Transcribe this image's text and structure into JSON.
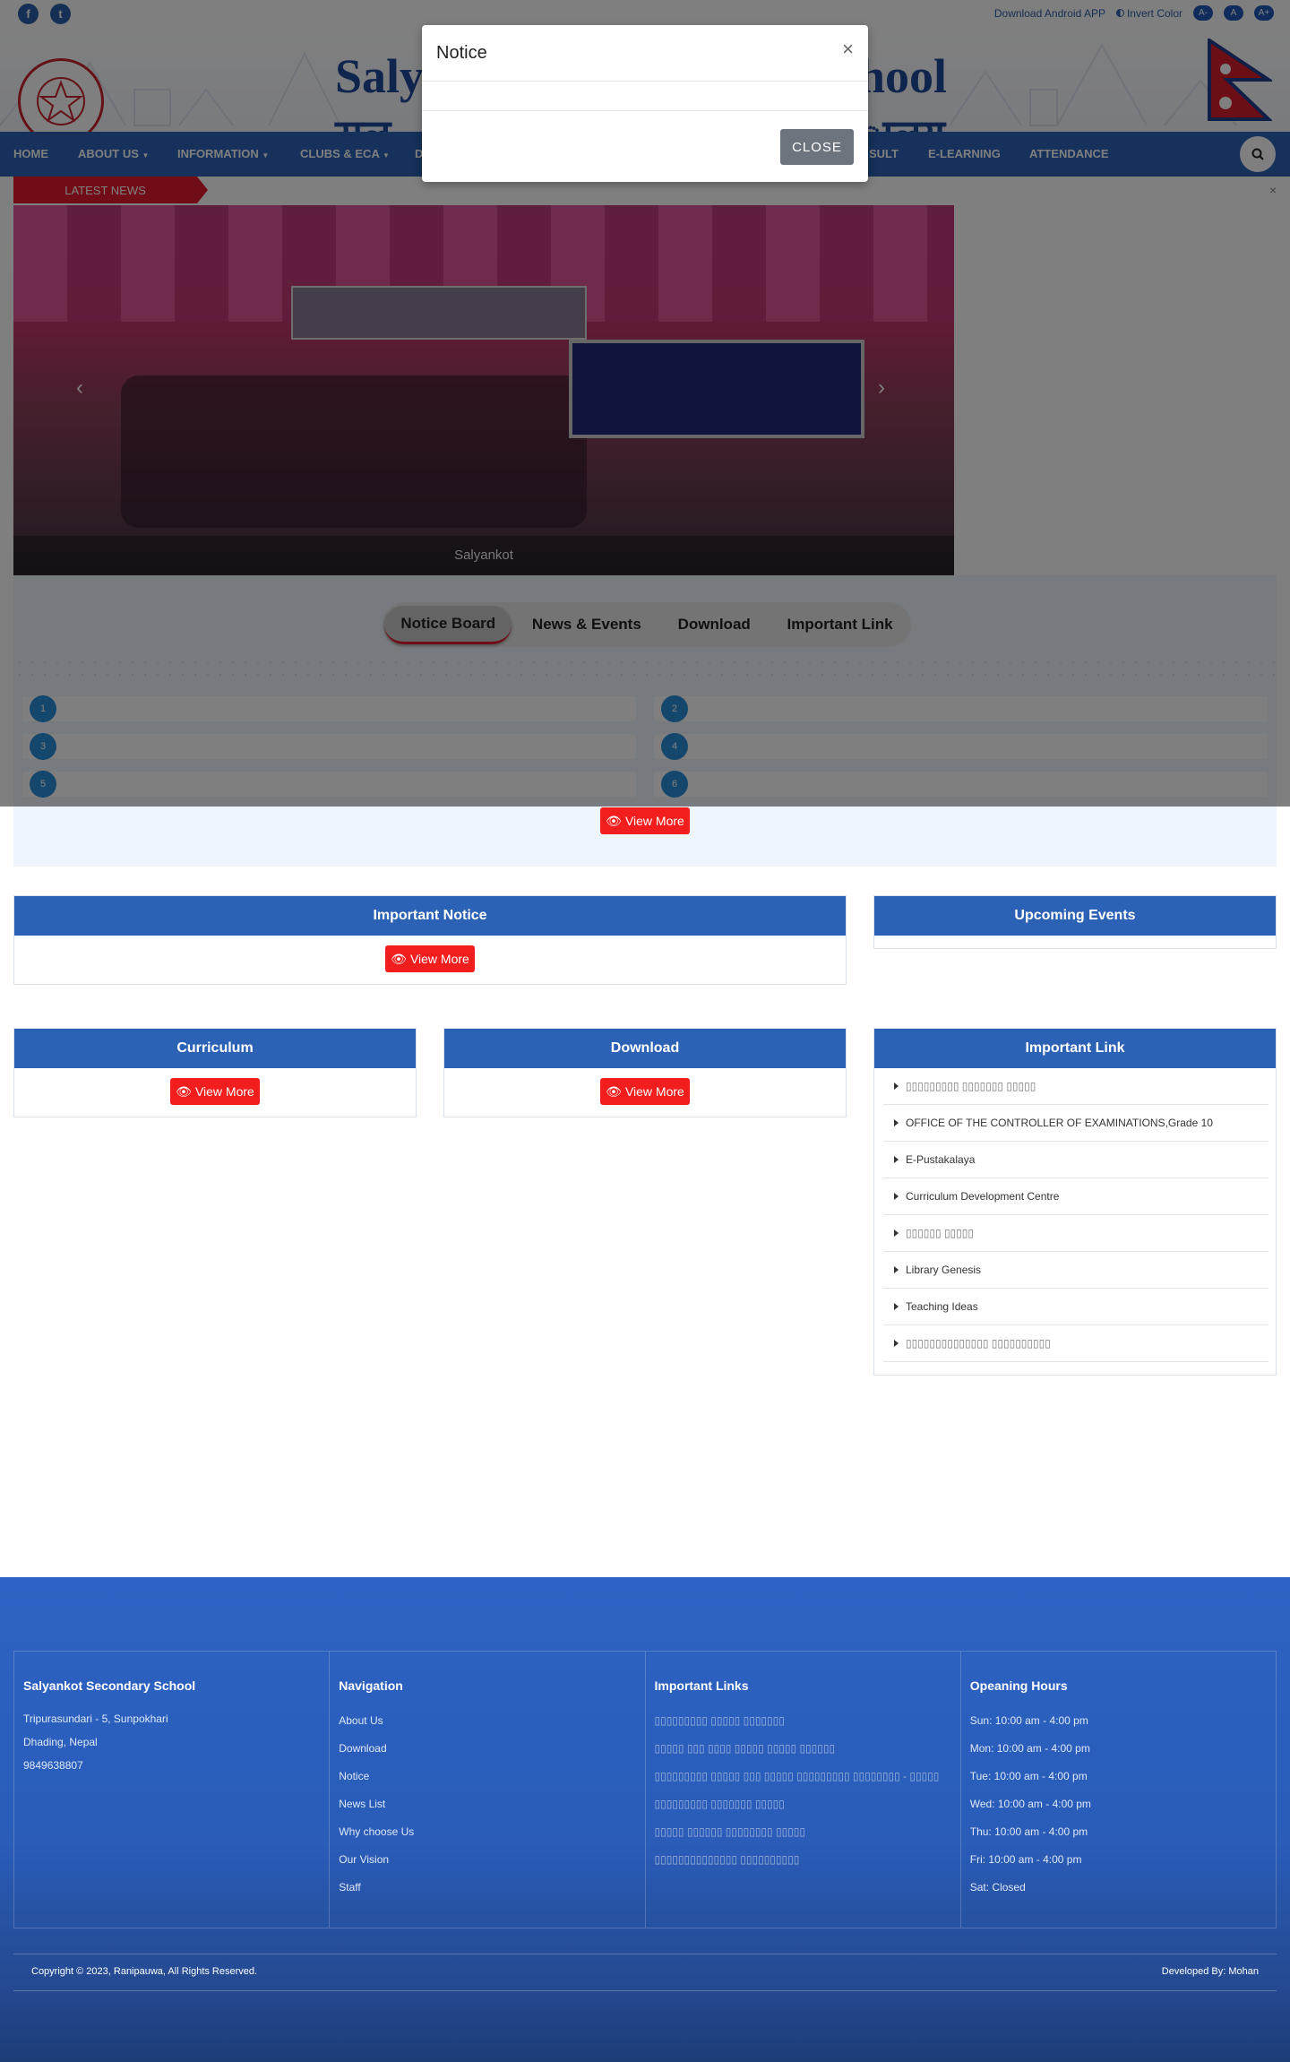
{
  "topbar": {
    "facebook_icon": "f",
    "twitter_icon": "t",
    "download_app": "Download Android APP",
    "invert_color": "Invert Color",
    "font_small": "A-",
    "font_normal": "A",
    "font_large": "A+"
  },
  "header": {
    "school_name_en_left": "Saly",
    "school_name_en_right": "hool",
    "school_name_ne_left": "सल्",
    "school_name_ne_right": "ालय"
  },
  "nav": {
    "items": [
      "HOME",
      "ABOUT US",
      "INFORMATION",
      "CLUBS & ECA",
      "D",
      "SULT",
      "E-LEARNING",
      "ATTENDANCE"
    ]
  },
  "news": {
    "label": "LATEST NEWS"
  },
  "slider": {
    "caption": "Salyankot"
  },
  "tabs": {
    "items": [
      "Notice Board",
      "News & Events",
      "Download",
      "Important Link"
    ],
    "active": "Notice Board"
  },
  "notice_board": {
    "numbers": [
      "1",
      "2",
      "3",
      "4",
      "5",
      "6"
    ]
  },
  "view_more": "View More",
  "modal": {
    "title": "Notice",
    "close_x": "×",
    "close_button": "CLOSE"
  },
  "cards": {
    "important_notice": "Important Notice",
    "upcoming_events": "Upcoming Events",
    "curriculum": "Curriculum",
    "download": "Download",
    "important_link": "Important Link"
  },
  "important_links": [
    "▯▯▯▯▯▯▯▯▯ ▯▯▯▯▯▯▯ ▯▯▯▯▯",
    "OFFICE OF THE CONTROLLER OF EXAMINATIONS,Grade 10",
    "E-Pustakalaya",
    "Curriculum Development Centre",
    "▯▯▯▯▯▯ ▯▯▯▯▯",
    "Library Genesis",
    "Teaching Ideas",
    "▯▯▯▯▯▯▯▯▯▯▯▯▯▯ ▯▯▯▯▯▯▯▯▯▯"
  ],
  "footer": {
    "school": {
      "title": "Salyankot Secondary School",
      "address1": " Tripurasundari - 5, Sunpokhari",
      "address2": "Dhading, Nepal",
      "phone": "9849638807"
    },
    "navigation": {
      "title": "Navigation",
      "items": [
        "About Us",
        "Download",
        "Notice",
        "News List",
        "Why choose Us",
        "Our Vision",
        "Staff"
      ]
    },
    "important_links": {
      "title": "Important Links",
      "items": [
        "▯▯▯▯▯▯▯▯▯ ▯▯▯▯▯ ▯▯▯▯▯▯▯",
        "▯▯▯▯▯ ▯▯▯ ▯▯▯▯ ▯▯▯▯▯ ▯▯▯▯▯ ▯▯▯▯▯▯",
        "▯▯▯▯▯▯▯▯▯ ▯▯▯▯▯ ▯▯▯ ▯▯▯▯▯ ▯▯▯▯▯▯▯▯▯ ▯▯▯▯▯▯▯▯ - ▯▯▯▯▯",
        "▯▯▯▯▯▯▯▯▯ ▯▯▯▯▯▯▯ ▯▯▯▯▯",
        "▯▯▯▯▯ ▯▯▯▯▯▯ ▯▯▯▯▯▯▯▯ ▯▯▯▯▯",
        "▯▯▯▯▯▯▯▯▯▯▯▯▯▯ ▯▯▯▯▯▯▯▯▯▯"
      ]
    },
    "hours": {
      "title": "Opeaning Hours",
      "items": [
        "Sun: 10:00 am - 4:00 pm",
        "Mon: 10:00 am - 4:00 pm",
        "Tue: 10:00 am - 4:00 pm",
        "Wed: 10:00 am - 4:00 pm",
        "Thu: 10:00 am - 4:00 pm",
        "Fri: 10:00 am - 4:00 pm",
        "Sat: Closed"
      ]
    },
    "copyright": "Copyright © 2023, Ranipauwa, All Rights Reserved.",
    "developed_by": "Developed By: Mohan"
  },
  "colors": {
    "primary_blue": "#2c62b6",
    "accent_red": "#e31b2e",
    "button_red": "#f21d1d"
  }
}
